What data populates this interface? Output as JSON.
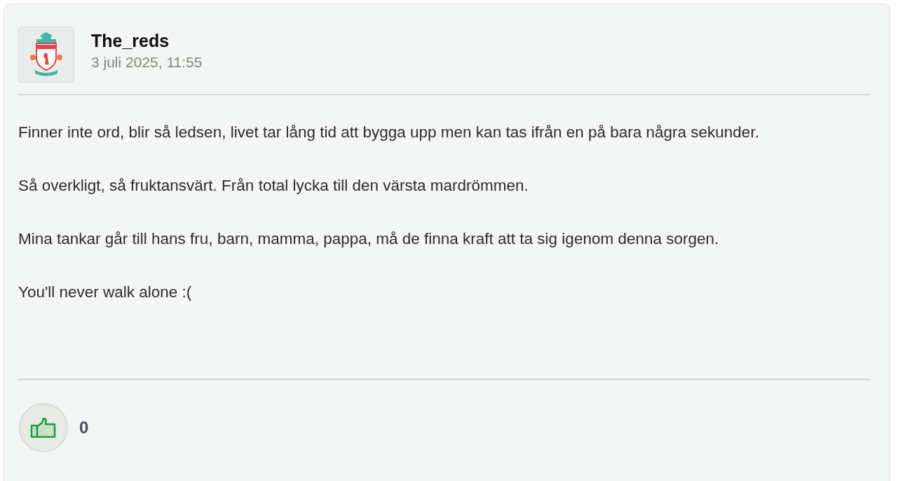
{
  "post": {
    "author": "The_reds",
    "timestamp": "3 juli 2025, 11:55",
    "paragraphs": [
      "Finner inte ord, blir så ledsen, livet tar lång tid att bygga upp men kan tas ifrån en på bara några sekunder.",
      "Så overkligt, så fruktansvärt. Från total lycka till den värsta mardrömmen.",
      "Mina tankar går till hans fru, barn, mamma, pappa, må de finna kraft att ta sig igenom denna sorgen.",
      "You'll never walk alone :("
    ],
    "likes": {
      "count": "0",
      "liked": false
    }
  }
}
